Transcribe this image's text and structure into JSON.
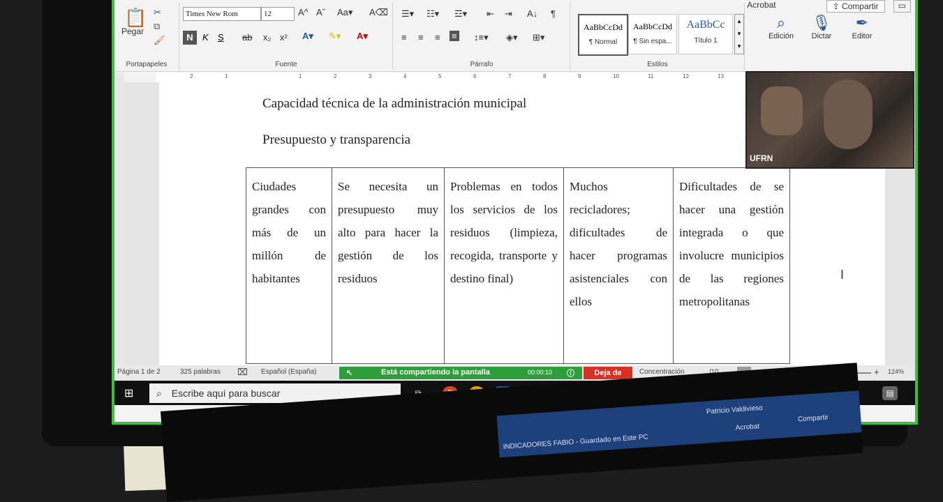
{
  "ribbon": {
    "topright": {
      "acrobat": "Acrobat",
      "share": "Compartir"
    },
    "clipboard": {
      "paste": "Pegar",
      "label": "Portapapeles"
    },
    "font": {
      "name": "Times New Rom",
      "size": "12",
      "bold": "N",
      "italic": "K",
      "underline": "S",
      "label": "Fuente"
    },
    "paragraph": {
      "label": "Párrafo"
    },
    "styles": {
      "label": "Estilos",
      "items": [
        {
          "preview": "AaBbCcDd",
          "name": "¶ Normal"
        },
        {
          "preview": "AaBbCcDd",
          "name": "¶ Sin espa..."
        },
        {
          "preview": "AaBbCc",
          "name": "Título 1"
        }
      ]
    },
    "editing": "Edición",
    "dictate": "Dictar",
    "editor": "Editor"
  },
  "ruler_marks": [
    "2",
    "1",
    "1",
    "2",
    "3",
    "4",
    "5",
    "6",
    "7",
    "8",
    "9",
    "10",
    "11",
    "12",
    "13"
  ],
  "document": {
    "line1": "Capacidad técnica de la administración municipal",
    "line2": "Presupuesto y transparencia",
    "table_row": [
      "Ciudades grandes con más de un millón de habitantes",
      "Se necesita un presupuesto muy alto para hacer la gestión de los residuos",
      "Problemas en todos los servicios de los residuos (limpieza, recogida, transporte y destino final)",
      "Muchos recicladores; dificultades de hacer programas asistenciales con ellos",
      "Dificultades de se hacer una gestión integrada o que involucre municipios de las regiones metropolitanas"
    ]
  },
  "webcam": {
    "label": "UFRN"
  },
  "statusbar": {
    "page": "Página 1 de 2",
    "words": "325 palabras",
    "language": "Español (España)",
    "sharing": "Está compartiendo la pantalla",
    "timer": "00:00:10",
    "stop": "Deja de",
    "focus": "Concentración",
    "zoom": "124%"
  },
  "taskbar": {
    "search_placeholder": "Escribe aquí para buscar"
  },
  "laptop": {
    "title": "INDICADORES FABIO - Guardado en Este PC",
    "user": "Patricio Valdivieso",
    "share": "Compartir",
    "acrobat": "Acrobat"
  }
}
